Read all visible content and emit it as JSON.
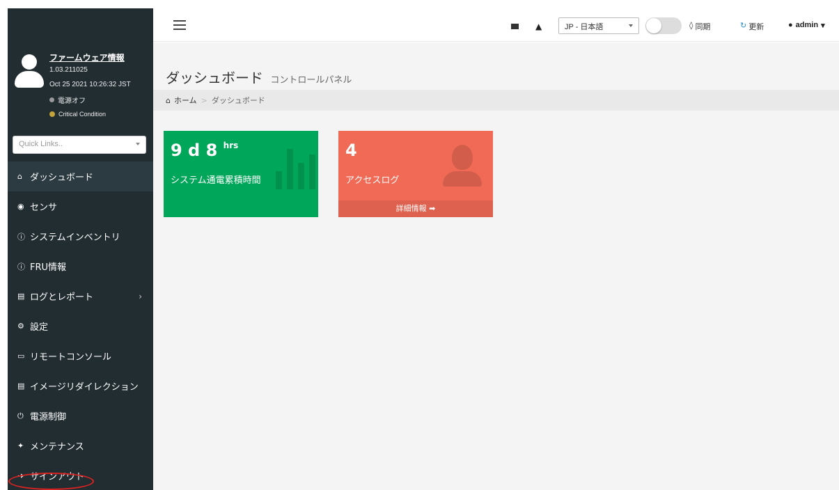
{
  "profile": {
    "firmware_link": "ファームウェア情報",
    "version": "1.03.211025",
    "datetime": "Oct 25 2021 10:26:32 JST",
    "power_status": "電源オフ",
    "condition": "Critical Condition"
  },
  "sidebar": {
    "quick_links_placeholder": "Quick Links..",
    "items": [
      {
        "label": "ダッシュボード",
        "icon": "home-icon"
      },
      {
        "label": "センサ",
        "icon": "dashboard-gauge-icon"
      },
      {
        "label": "システムインベントリ",
        "icon": "info-icon"
      },
      {
        "label": "FRU情報",
        "icon": "info-icon"
      },
      {
        "label": "ログとレポート",
        "icon": "bar-chart-icon"
      },
      {
        "label": "設定",
        "icon": "gear-icon"
      },
      {
        "label": "リモートコンソール",
        "icon": "monitor-icon"
      },
      {
        "label": "イメージリダイレクション",
        "icon": "disk-icon"
      },
      {
        "label": "電源制御",
        "icon": "power-icon"
      },
      {
        "label": "メンテナンス",
        "icon": "wrench-icon"
      },
      {
        "label": "サインアウト",
        "icon": "sign-out-icon"
      }
    ]
  },
  "header": {
    "language": "JP - 日本語",
    "sync_label": "同期",
    "refresh_label": "更新",
    "user": "admin"
  },
  "main": {
    "title": "ダッシュボード",
    "subtitle": "コントロールパネル",
    "breadcrumb": {
      "home": "ホーム",
      "current": "ダッシュボード"
    }
  },
  "cards": [
    {
      "value": "9 d 8",
      "unit": "hrs",
      "label": "システム通電累積時間",
      "color": "#00a65a"
    },
    {
      "value": "4",
      "label": "アクセスログ",
      "footer": "詳細情報",
      "color": "#f06a55"
    }
  ],
  "colors": {
    "sidebar_bg": "#222d32",
    "accent_blue": "#2c8fd0",
    "highlight_ring": "#dd2222"
  }
}
